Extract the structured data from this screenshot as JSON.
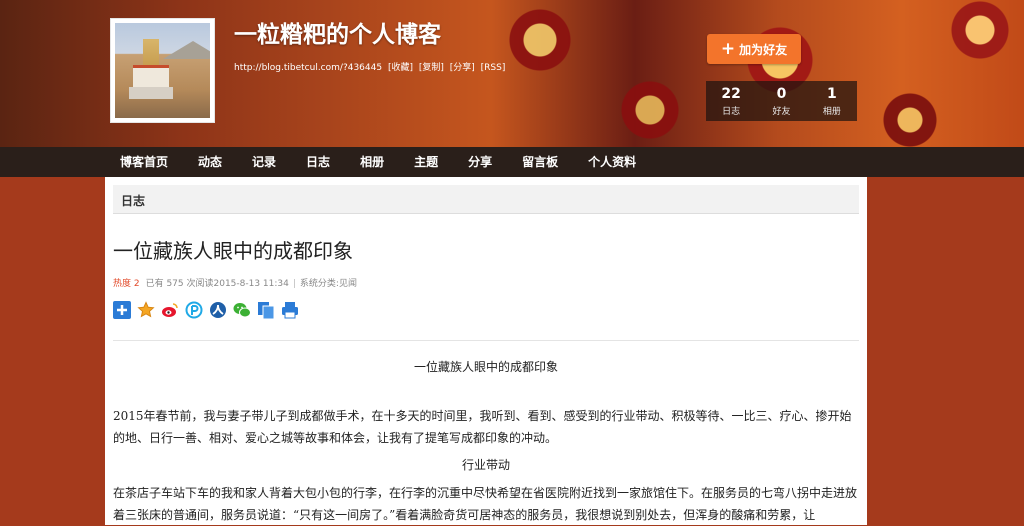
{
  "header": {
    "blog_title": "一粒糌粑的个人博客",
    "url": "http://blog.tibetcul.com/?436445",
    "url_links": [
      "[收藏]",
      "[复制]",
      "[分享]",
      "[RSS]"
    ],
    "add_friend": "加为好友",
    "stats": [
      {
        "value": "22",
        "label": "日志"
      },
      {
        "value": "0",
        "label": "好友"
      },
      {
        "value": "1",
        "label": "相册"
      }
    ]
  },
  "nav": [
    "博客首页",
    "动态",
    "记录",
    "日志",
    "相册",
    "主题",
    "分享",
    "留言板",
    "个人资料"
  ],
  "section": "日志",
  "post": {
    "title": "一位藏族人眼中的成都印象",
    "hot_label": "热度 2",
    "meta": "已有 575 次阅读2015-8-13 11:34",
    "category": "系统分类:见闻",
    "share_icons": [
      "add-share-icon",
      "favorite-star-icon",
      "weibo-icon",
      "pengyou-icon",
      "renren-icon",
      "wechat-icon",
      "copy-icon",
      "print-icon"
    ],
    "article_title": "一位藏族人眼中的成都印象",
    "paragraph1": "2015年春节前，我与妻子带儿子到成都做手术，在十多天的时间里，我听到、看到、感受到的行业带动、积极等待、一比三、疗心、掺开始的地、日行一善、相对、爱心之城等故事和体会，让我有了提笔写成都印象的冲动。",
    "subheading": "行业带动",
    "paragraph2": "在茶店子车站下车的我和家人背着大包小包的行李，在行李的沉重中尽快希望在省医院附近找到一家旅馆住下。在服务员的七弯八拐中走进放着三张床的普通间，服务员说道：“只有这一间房了。”看着满脸奇货可居神态的服务员，我很想说到别处去，但浑身的酸痛和劳累，让"
  },
  "colors": {
    "accent": "#f3742b",
    "hot": "#e24a2a",
    "nav_bg": "#2a1f1a",
    "page_bg": "#a53a1c"
  }
}
